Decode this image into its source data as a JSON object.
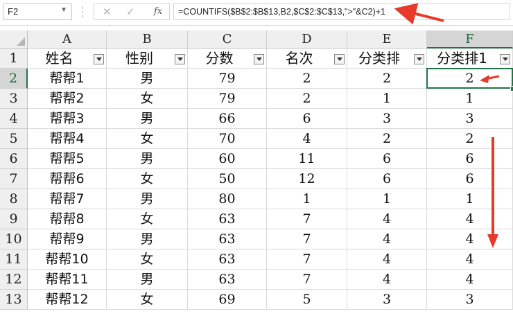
{
  "name_box": "F2",
  "formula": "=COUNTIFS($B$2:$B$13,B2,$C$2:$C$13,\">\"&C2)+1",
  "fx_label": "fx",
  "columns": [
    "A",
    "B",
    "C",
    "D",
    "E",
    "F"
  ],
  "headers": [
    "姓名",
    "性别",
    "分数",
    "名次",
    "分类排",
    "分类排1"
  ],
  "rows": [
    {
      "num": "1"
    },
    {
      "num": "2",
      "cells": [
        "帮帮1",
        "男",
        "79",
        "2",
        "2",
        "2"
      ]
    },
    {
      "num": "3",
      "cells": [
        "帮帮2",
        "女",
        "79",
        "2",
        "1",
        "1"
      ]
    },
    {
      "num": "4",
      "cells": [
        "帮帮3",
        "男",
        "66",
        "6",
        "3",
        "3"
      ]
    },
    {
      "num": "5",
      "cells": [
        "帮帮4",
        "女",
        "70",
        "4",
        "2",
        "2"
      ]
    },
    {
      "num": "6",
      "cells": [
        "帮帮5",
        "男",
        "60",
        "11",
        "6",
        "6"
      ]
    },
    {
      "num": "7",
      "cells": [
        "帮帮6",
        "女",
        "50",
        "12",
        "6",
        "6"
      ]
    },
    {
      "num": "8",
      "cells": [
        "帮帮7",
        "男",
        "80",
        "1",
        "1",
        "1"
      ]
    },
    {
      "num": "9",
      "cells": [
        "帮帮8",
        "女",
        "63",
        "7",
        "4",
        "4"
      ]
    },
    {
      "num": "10",
      "cells": [
        "帮帮9",
        "男",
        "63",
        "7",
        "4",
        "4"
      ]
    },
    {
      "num": "11",
      "cells": [
        "帮帮10",
        "女",
        "63",
        "7",
        "4",
        "4"
      ]
    },
    {
      "num": "12",
      "cells": [
        "帮帮11",
        "男",
        "63",
        "7",
        "4",
        "4"
      ]
    },
    {
      "num": "13",
      "cells": [
        "帮帮12",
        "女",
        "69",
        "5",
        "3",
        "3"
      ]
    }
  ],
  "selected_cell": "F2",
  "accent_color": "#217346",
  "annotation_color": "#e8392b"
}
